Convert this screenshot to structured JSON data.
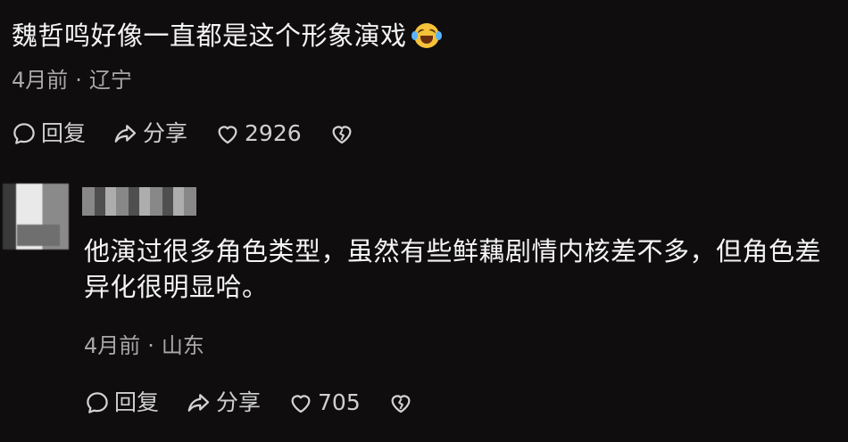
{
  "comments": [
    {
      "text": "魏哲鸣好像一直都是这个形象演戏",
      "emoji_icon": "laughing-crying-face-icon",
      "time": "4月前",
      "location": "辽宁",
      "reply_label": "回复",
      "share_label": "分享",
      "like_count": "2926"
    },
    {
      "text": "他演过很多角色类型，虽然有些鲜藕剧情内核差不多，但角色差异化很明显哈。",
      "time": "4月前",
      "location": "山东",
      "reply_label": "回复",
      "share_label": "分享",
      "like_count": "705"
    }
  ],
  "separator": "·"
}
